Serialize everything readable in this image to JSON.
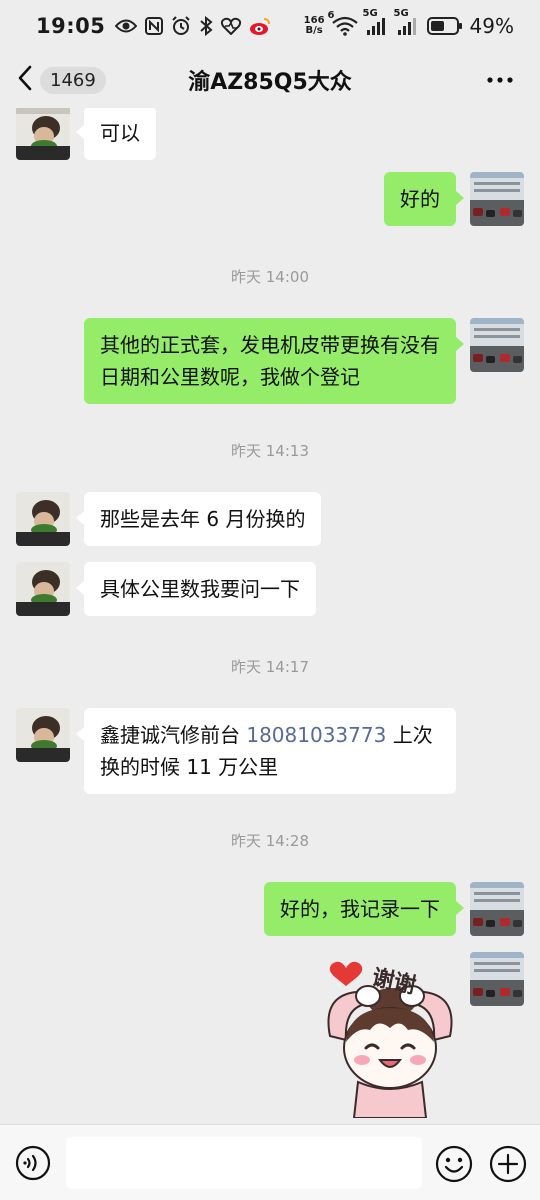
{
  "status_bar": {
    "time": "19:05",
    "net_speed_value": "166",
    "net_speed_unit": "B/s",
    "wifi_badge": "6",
    "sim1": "5G",
    "sim2": "5G",
    "battery_percent": "49%"
  },
  "header": {
    "unread_count": "1469",
    "title": "渝AZ85Q5大众"
  },
  "messages": [
    {
      "side": "left",
      "text": "可以"
    },
    {
      "side": "right",
      "text": "好的"
    },
    {
      "timestamp": "昨天 14:00"
    },
    {
      "side": "right",
      "text": "其他的正式套，发电机皮带更换有没有日期和公里数呢，我做个登记"
    },
    {
      "timestamp": "昨天 14:13"
    },
    {
      "side": "left",
      "text": "那些是去年 6 月份换的"
    },
    {
      "side": "left",
      "text": "具体公里数我要问一下"
    },
    {
      "timestamp": "昨天 14:17"
    },
    {
      "side": "left",
      "text_before": "鑫捷诚汽修前台 ",
      "phone": "18081033773",
      "text_after": " 上次换的时候 11 万公里"
    },
    {
      "timestamp": "昨天 14:28"
    },
    {
      "side": "right",
      "text": "好的，我记录一下"
    },
    {
      "side": "right",
      "sticker": true,
      "sticker_text": "谢谢"
    }
  ],
  "input": {
    "value": "",
    "placeholder": ""
  },
  "colors": {
    "background": "#ededed",
    "bubble_sent": "#95ec69",
    "bubble_received": "#ffffff",
    "link": "#576b95"
  },
  "icons": [
    "back-arrow-icon",
    "more-icon",
    "voice-icon",
    "emoji-icon",
    "plus-icon"
  ]
}
